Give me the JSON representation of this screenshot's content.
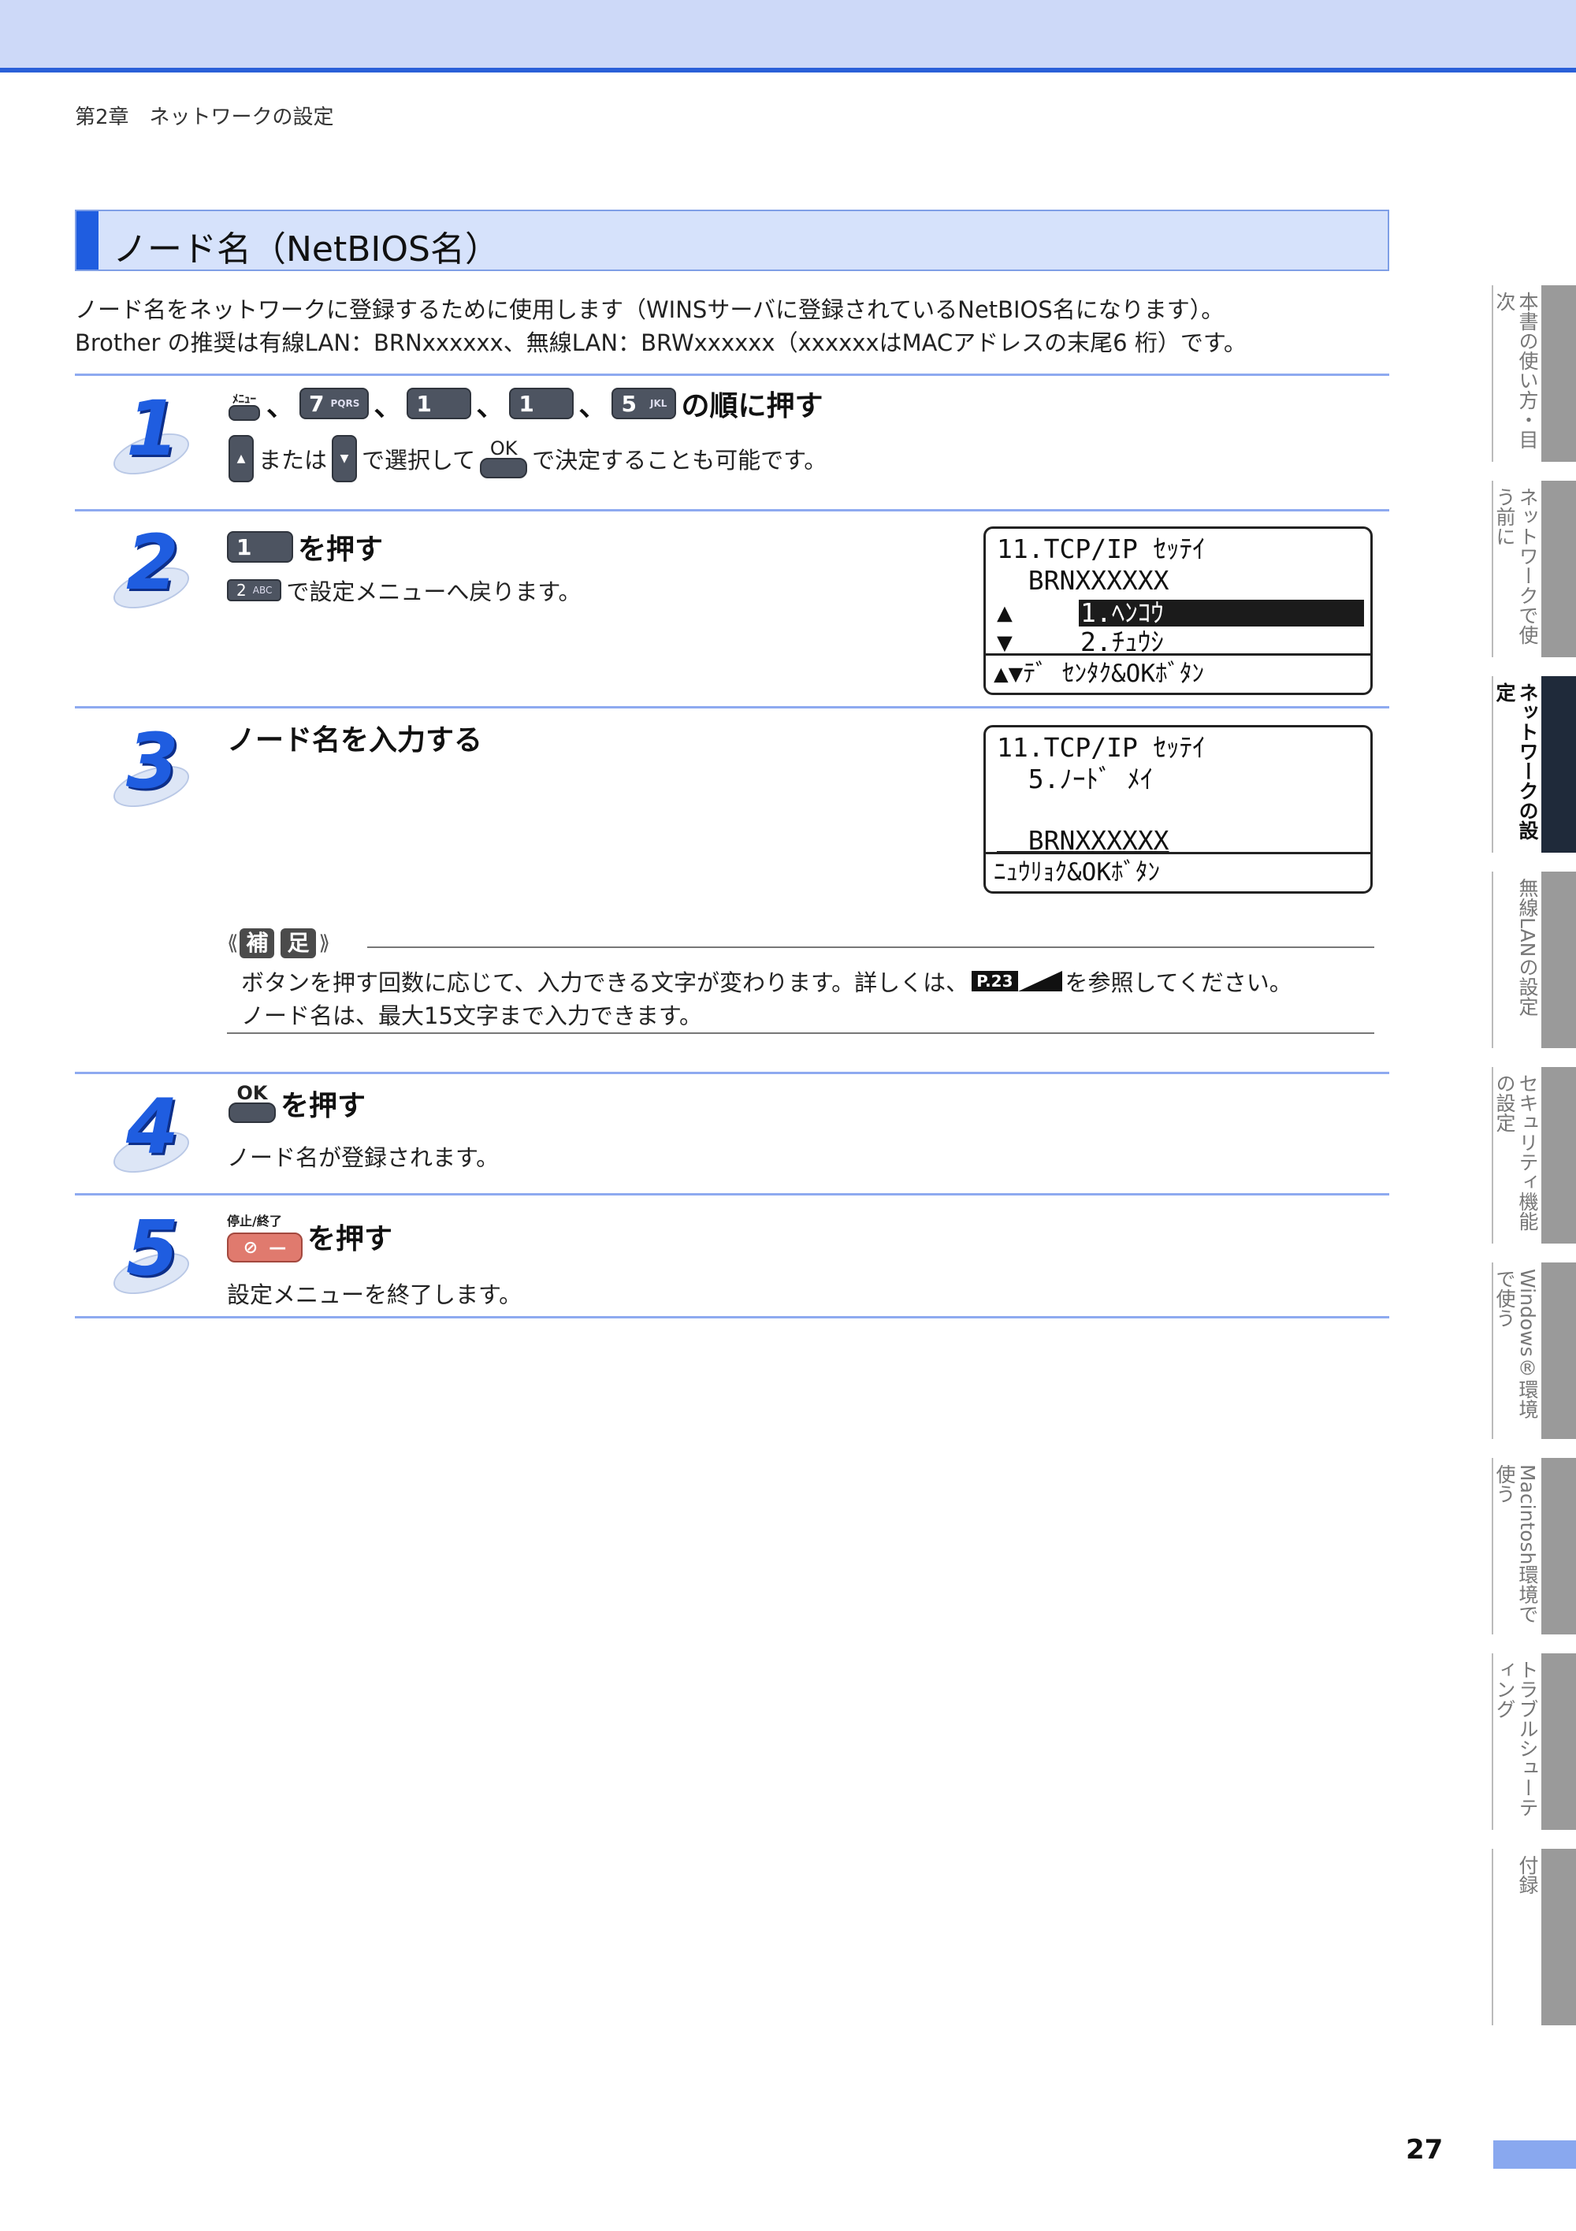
{
  "header": {
    "chapter": "第2章　ネットワークの設定"
  },
  "section": {
    "title": "ノード名（NetBIOS名）"
  },
  "intro": {
    "line1": "ノード名をネットワークに登録するために使用します（WINSサーバに登録されているNetBIOS名になります）。",
    "line2": "Brother の推奨は有線LAN：BRNxxxxxx、無線LAN：BRWxxxxxx（xxxxxxはMACアドレスの末尾6 桁）です。"
  },
  "step1": {
    "num": "1",
    "menu_key_label": "ﾒﾆｭｰ",
    "sep": "、",
    "key7": "7",
    "key7_sub": "PQRS",
    "key1": "1",
    "key5": "5",
    "key5_sub": "JKL",
    "title_suffix": "の順に押す",
    "alt_or": "または",
    "alt_select": "で選択して",
    "ok_label": "OK",
    "alt_suffix": "で決定することも可能です。"
  },
  "step2": {
    "num": "2",
    "key": "1",
    "title_suffix": "を押す",
    "key_small": "2",
    "key_small_sub": "ABC",
    "text": "で設定メニューへ戻ります。",
    "lcd": {
      "line1": "11.TCP/IP ｾｯﾃｲ",
      "line2": "  BRNXXXXXX",
      "line3_arrow": "▲",
      "line3_hl": "1.ﾍﾝｺｳ",
      "line4_arrow": "▼",
      "line4": "2.ﾁｭｳｼ",
      "footer": "▲▼ﾃﾞ ｾﾝﾀｸ&OKﾎﾞﾀﾝ"
    }
  },
  "step3": {
    "num": "3",
    "title": "ノード名を入力する",
    "lcd": {
      "line1": "11.TCP/IP ｾｯﾃｲ",
      "line2": "  5.ﾉｰﾄﾞ ﾒｲ",
      "line4": "  BRNXXXXXX",
      "footer": "ﾆｭｳﾘｮｸ&OKﾎﾞﾀﾝ"
    }
  },
  "note": {
    "badge1": "補",
    "badge2": "足",
    "line1_pre": "ボタンを押す回数に応じて、入力できる文字が変わります。詳しくは、",
    "page_ref": "P.23",
    "line1_post": "を参照してください。",
    "line2": "ノード名は、最大15文字まで入力できます。"
  },
  "step4": {
    "num": "4",
    "ok_label": "OK",
    "title_suffix": "を押す",
    "text": "ノード名が登録されます。"
  },
  "step5": {
    "num": "5",
    "stop_label": "停止/終了",
    "stop_icon": "⊘",
    "stop_dash": "—",
    "title_suffix": "を押す",
    "text": "設定メニューを終了します。"
  },
  "tabs": [
    {
      "label": "本書の使い方・目次"
    },
    {
      "label": "ネットワークで使う前に"
    },
    {
      "label": "ネットワークの設定"
    },
    {
      "label": "無線LANの設定"
    },
    {
      "label": "セキュリティ機能の設定"
    },
    {
      "label": "Windows®環境で使う"
    },
    {
      "label": "Macintosh環境で使う"
    },
    {
      "label": "トラブルシューティング"
    },
    {
      "label": "付録"
    }
  ],
  "page_number": "27",
  "colors": {
    "accent": "#1f5de0",
    "band": "#cdd9f8",
    "active_tab": "#1f2a3a"
  }
}
